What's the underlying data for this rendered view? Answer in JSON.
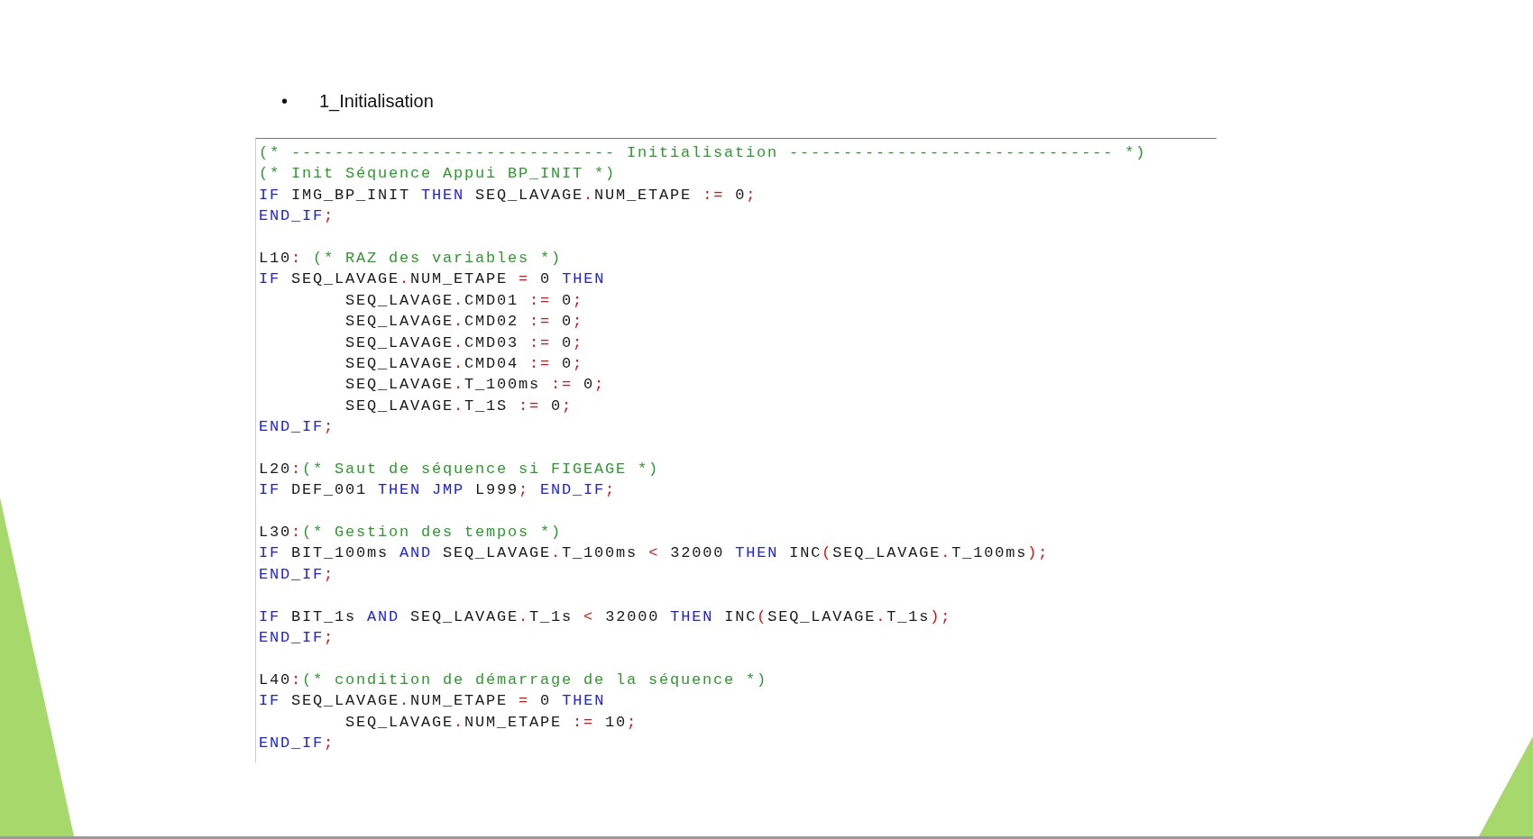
{
  "bullet": {
    "marker": "•",
    "text": "1_Initialisation"
  },
  "code_lines": [
    {
      "kind": "code",
      "tokens": [
        {
          "kind": "comment",
          "text": "(* ------------------------------ Initialisation ------------------------------ *)"
        }
      ]
    },
    {
      "kind": "code",
      "tokens": [
        {
          "kind": "comment",
          "text": "(* Init Séquence Appui BP_INIT *)"
        }
      ]
    },
    {
      "kind": "code",
      "tokens": [
        {
          "kind": "keyword",
          "text": "IF"
        },
        {
          "kind": "plain",
          "text": " IMG_BP_INIT "
        },
        {
          "kind": "keyword",
          "text": "THEN"
        },
        {
          "kind": "plain",
          "text": " SEQ_LAVAGE"
        },
        {
          "kind": "operator",
          "text": "."
        },
        {
          "kind": "plain",
          "text": "NUM_ETAPE "
        },
        {
          "kind": "operator",
          "text": ":="
        },
        {
          "kind": "plain",
          "text": " 0"
        },
        {
          "kind": "operator",
          "text": ";"
        }
      ]
    },
    {
      "kind": "code",
      "tokens": [
        {
          "kind": "keyword",
          "text": "END_IF"
        },
        {
          "kind": "operator",
          "text": ";"
        }
      ]
    },
    {
      "kind": "blank"
    },
    {
      "kind": "code",
      "tokens": [
        {
          "kind": "plain",
          "text": "L10"
        },
        {
          "kind": "operator",
          "text": ": "
        },
        {
          "kind": "comment",
          "text": "(* RAZ des variables *)"
        }
      ]
    },
    {
      "kind": "code",
      "tokens": [
        {
          "kind": "keyword",
          "text": "IF"
        },
        {
          "kind": "plain",
          "text": " SEQ_LAVAGE"
        },
        {
          "kind": "operator",
          "text": "."
        },
        {
          "kind": "plain",
          "text": "NUM_ETAPE "
        },
        {
          "kind": "operator",
          "text": "="
        },
        {
          "kind": "plain",
          "text": " 0 "
        },
        {
          "kind": "keyword",
          "text": "THEN"
        }
      ]
    },
    {
      "kind": "code",
      "tokens": [
        {
          "kind": "plain",
          "text": "        SEQ_LAVAGE"
        },
        {
          "kind": "operator",
          "text": "."
        },
        {
          "kind": "plain",
          "text": "CMD01 "
        },
        {
          "kind": "operator",
          "text": ":="
        },
        {
          "kind": "plain",
          "text": " 0"
        },
        {
          "kind": "operator",
          "text": ";"
        }
      ]
    },
    {
      "kind": "code",
      "tokens": [
        {
          "kind": "plain",
          "text": "        SEQ_LAVAGE"
        },
        {
          "kind": "operator",
          "text": "."
        },
        {
          "kind": "plain",
          "text": "CMD02 "
        },
        {
          "kind": "operator",
          "text": ":="
        },
        {
          "kind": "plain",
          "text": " 0"
        },
        {
          "kind": "operator",
          "text": ";"
        }
      ]
    },
    {
      "kind": "code",
      "tokens": [
        {
          "kind": "plain",
          "text": "        SEQ_LAVAGE"
        },
        {
          "kind": "operator",
          "text": "."
        },
        {
          "kind": "plain",
          "text": "CMD03 "
        },
        {
          "kind": "operator",
          "text": ":="
        },
        {
          "kind": "plain",
          "text": " 0"
        },
        {
          "kind": "operator",
          "text": ";"
        }
      ]
    },
    {
      "kind": "code",
      "tokens": [
        {
          "kind": "plain",
          "text": "        SEQ_LAVAGE"
        },
        {
          "kind": "operator",
          "text": "."
        },
        {
          "kind": "plain",
          "text": "CMD04 "
        },
        {
          "kind": "operator",
          "text": ":="
        },
        {
          "kind": "plain",
          "text": " 0"
        },
        {
          "kind": "operator",
          "text": ";"
        }
      ]
    },
    {
      "kind": "code",
      "tokens": [
        {
          "kind": "plain",
          "text": "        SEQ_LAVAGE"
        },
        {
          "kind": "operator",
          "text": "."
        },
        {
          "kind": "plain",
          "text": "T_100ms "
        },
        {
          "kind": "operator",
          "text": ":="
        },
        {
          "kind": "plain",
          "text": " 0"
        },
        {
          "kind": "operator",
          "text": ";"
        }
      ]
    },
    {
      "kind": "code",
      "tokens": [
        {
          "kind": "plain",
          "text": "        SEQ_LAVAGE"
        },
        {
          "kind": "operator",
          "text": "."
        },
        {
          "kind": "plain",
          "text": "T_1S "
        },
        {
          "kind": "operator",
          "text": ":="
        },
        {
          "kind": "plain",
          "text": " 0"
        },
        {
          "kind": "operator",
          "text": ";"
        }
      ]
    },
    {
      "kind": "code",
      "tokens": [
        {
          "kind": "keyword",
          "text": "END_IF"
        },
        {
          "kind": "operator",
          "text": ";"
        }
      ]
    },
    {
      "kind": "blank"
    },
    {
      "kind": "code",
      "tokens": [
        {
          "kind": "plain",
          "text": "L20"
        },
        {
          "kind": "operator",
          "text": ":"
        },
        {
          "kind": "comment",
          "text": "(* Saut de séquence si FIGEAGE *)"
        }
      ]
    },
    {
      "kind": "code",
      "tokens": [
        {
          "kind": "keyword",
          "text": "IF"
        },
        {
          "kind": "plain",
          "text": " DEF_001 "
        },
        {
          "kind": "keyword",
          "text": "THEN JMP"
        },
        {
          "kind": "plain",
          "text": " L999"
        },
        {
          "kind": "operator",
          "text": "; "
        },
        {
          "kind": "keyword",
          "text": "END_IF"
        },
        {
          "kind": "operator",
          "text": ";"
        }
      ]
    },
    {
      "kind": "blank"
    },
    {
      "kind": "code",
      "tokens": [
        {
          "kind": "plain",
          "text": "L30"
        },
        {
          "kind": "operator",
          "text": ":"
        },
        {
          "kind": "comment",
          "text": "(* Gestion des tempos *)"
        }
      ]
    },
    {
      "kind": "code",
      "tokens": [
        {
          "kind": "keyword",
          "text": "IF"
        },
        {
          "kind": "plain",
          "text": " BIT_100ms "
        },
        {
          "kind": "keyword",
          "text": "AND"
        },
        {
          "kind": "plain",
          "text": " SEQ_LAVAGE"
        },
        {
          "kind": "operator",
          "text": "."
        },
        {
          "kind": "plain",
          "text": "T_100ms "
        },
        {
          "kind": "operator",
          "text": "<"
        },
        {
          "kind": "plain",
          "text": " 32000 "
        },
        {
          "kind": "keyword",
          "text": "THEN"
        },
        {
          "kind": "plain",
          "text": " INC"
        },
        {
          "kind": "operator",
          "text": "("
        },
        {
          "kind": "plain",
          "text": "SEQ_LAVAGE"
        },
        {
          "kind": "operator",
          "text": "."
        },
        {
          "kind": "plain",
          "text": "T_100ms"
        },
        {
          "kind": "operator",
          "text": ");"
        }
      ]
    },
    {
      "kind": "code",
      "tokens": [
        {
          "kind": "keyword",
          "text": "END_IF"
        },
        {
          "kind": "operator",
          "text": ";"
        }
      ]
    },
    {
      "kind": "blank"
    },
    {
      "kind": "code",
      "tokens": [
        {
          "kind": "keyword",
          "text": "IF"
        },
        {
          "kind": "plain",
          "text": " BIT_1s "
        },
        {
          "kind": "keyword",
          "text": "AND"
        },
        {
          "kind": "plain",
          "text": " SEQ_LAVAGE"
        },
        {
          "kind": "operator",
          "text": "."
        },
        {
          "kind": "plain",
          "text": "T_1s "
        },
        {
          "kind": "operator",
          "text": "<"
        },
        {
          "kind": "plain",
          "text": " 32000 "
        },
        {
          "kind": "keyword",
          "text": "THEN"
        },
        {
          "kind": "plain",
          "text": " INC"
        },
        {
          "kind": "operator",
          "text": "("
        },
        {
          "kind": "plain",
          "text": "SEQ_LAVAGE"
        },
        {
          "kind": "operator",
          "text": "."
        },
        {
          "kind": "plain",
          "text": "T_1s"
        },
        {
          "kind": "operator",
          "text": ");"
        }
      ]
    },
    {
      "kind": "code",
      "tokens": [
        {
          "kind": "keyword",
          "text": "END_IF"
        },
        {
          "kind": "operator",
          "text": ";"
        }
      ]
    },
    {
      "kind": "blank"
    },
    {
      "kind": "code",
      "tokens": [
        {
          "kind": "plain",
          "text": "L40"
        },
        {
          "kind": "operator",
          "text": ":"
        },
        {
          "kind": "comment",
          "text": "(* condition de démarrage de la séquence *)"
        }
      ]
    },
    {
      "kind": "code",
      "tokens": [
        {
          "kind": "keyword",
          "text": "IF"
        },
        {
          "kind": "plain",
          "text": " SEQ_LAVAGE"
        },
        {
          "kind": "operator",
          "text": "."
        },
        {
          "kind": "plain",
          "text": "NUM_ETAPE "
        },
        {
          "kind": "operator",
          "text": "="
        },
        {
          "kind": "plain",
          "text": " 0 "
        },
        {
          "kind": "keyword",
          "text": "THEN"
        }
      ]
    },
    {
      "kind": "code",
      "tokens": [
        {
          "kind": "plain",
          "text": "        SEQ_LAVAGE"
        },
        {
          "kind": "operator",
          "text": "."
        },
        {
          "kind": "plain",
          "text": "NUM_ETAPE "
        },
        {
          "kind": "operator",
          "text": ":="
        },
        {
          "kind": "plain",
          "text": " 10"
        },
        {
          "kind": "operator",
          "text": ";"
        }
      ]
    },
    {
      "kind": "code",
      "tokens": [
        {
          "kind": "keyword",
          "text": "END_IF"
        },
        {
          "kind": "operator",
          "text": ";"
        }
      ]
    }
  ]
}
